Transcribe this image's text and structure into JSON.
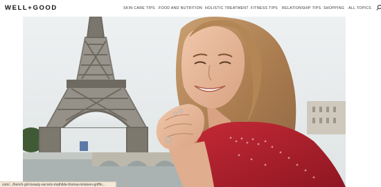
{
  "header": {
    "logo_text": "WELL+GOOD",
    "nav": [
      {
        "label": "SKIN CARE TIPS"
      },
      {
        "label": "FOOD AND NUTRITION"
      },
      {
        "label": "HOLISTIC TREATMENT"
      },
      {
        "label": "FITNESS TIPS"
      },
      {
        "label": "RELATIONSHIP TIPS"
      },
      {
        "label": "SHOPPING"
      },
      {
        "label": "ALL TOPICS"
      }
    ],
    "search_icon": "search-icon"
  },
  "hero": {
    "image_subject": "woman-smiling-near-eiffel-tower"
  },
  "status_bar": {
    "url": "com/.../french-girl-beauty-secrets-mathilde-thomas-kristeen-griffin..."
  },
  "colors": {
    "sky": "#e7ebec",
    "shirt": "#b8202e",
    "hair": "#b98a5c",
    "skin": "#e8b99a",
    "tower": "#6e6a62",
    "status_bg": "#f4e9d8"
  }
}
